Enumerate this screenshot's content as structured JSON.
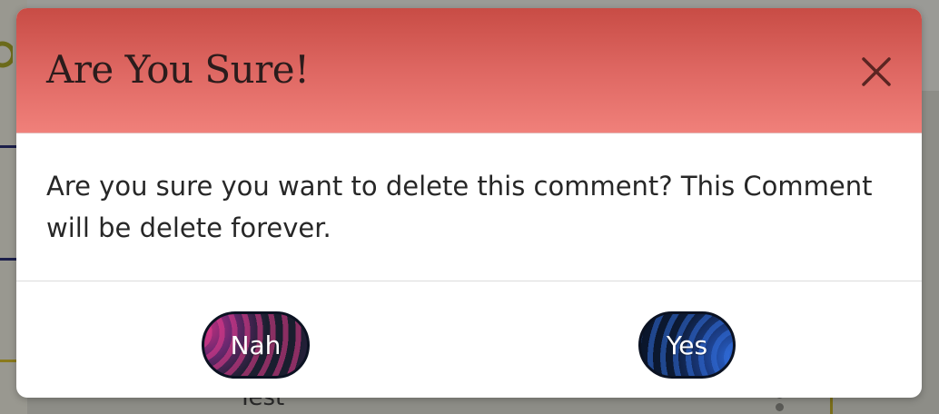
{
  "modal": {
    "title": "Are You Sure!",
    "message": "Are you sure you want to delete this comment? This Comment will be delete forever.",
    "close_icon": "close-icon",
    "buttons": {
      "nah_label": "Nah",
      "yes_label": "Yes"
    }
  },
  "background": {
    "partial_text": "Test"
  },
  "colors": {
    "header_top": "#c84c45",
    "header_bottom": "#f0807a",
    "title_text": "#2b1c1c",
    "body_text": "#272727",
    "nah_accent": "#e0337a",
    "yes_accent": "#2a64d0",
    "button_border": "#0b1222"
  }
}
